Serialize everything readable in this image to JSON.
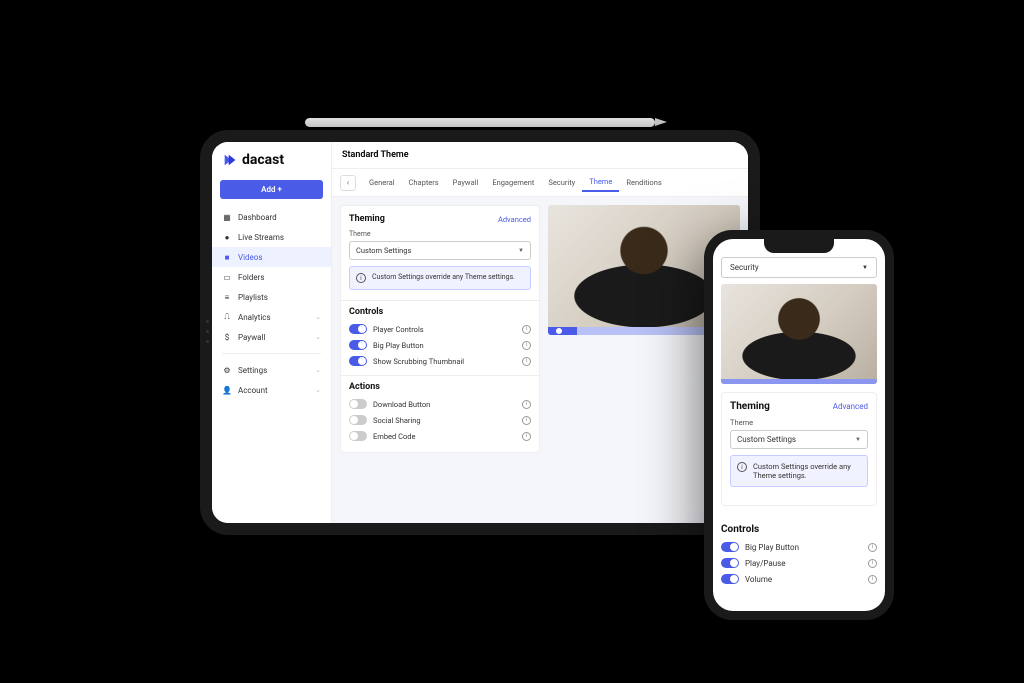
{
  "brand": {
    "name": "dacast"
  },
  "sidebar": {
    "add_label": "Add +",
    "items": [
      {
        "label": "Dashboard",
        "icon": "dashboard-icon"
      },
      {
        "label": "Live Streams",
        "icon": "camera-icon"
      },
      {
        "label": "Videos",
        "icon": "video-icon",
        "active": true
      },
      {
        "label": "Folders",
        "icon": "folder-icon"
      },
      {
        "label": "Playlists",
        "icon": "list-icon"
      },
      {
        "label": "Analytics",
        "icon": "chart-icon",
        "expandable": true
      },
      {
        "label": "Paywall",
        "icon": "dollar-icon",
        "expandable": true
      }
    ],
    "footer": [
      {
        "label": "Settings",
        "icon": "gear-icon",
        "expandable": true
      },
      {
        "label": "Account",
        "icon": "user-icon",
        "expandable": true
      }
    ]
  },
  "page": {
    "title": "Standard Theme",
    "tabs": [
      "General",
      "Chapters",
      "Paywall",
      "Engagement",
      "Security",
      "Theme",
      "Renditions"
    ],
    "active_tab": "Theme"
  },
  "theming": {
    "heading": "Theming",
    "advanced_link": "Advanced",
    "field_label": "Theme",
    "selected": "Custom Settings",
    "notice": "Custom Settings override any Theme settings."
  },
  "controls": {
    "heading": "Controls",
    "items": [
      {
        "label": "Player Controls",
        "on": true
      },
      {
        "label": "Big Play Button",
        "on": true
      },
      {
        "label": "Show Scrubbing Thumbnail",
        "on": true
      }
    ]
  },
  "actions": {
    "heading": "Actions",
    "items": [
      {
        "label": "Download Button",
        "on": false
      },
      {
        "label": "Social Sharing",
        "on": false
      },
      {
        "label": "Embed Code",
        "on": false
      }
    ]
  },
  "phone": {
    "select_value": "Security",
    "theming": {
      "heading": "Theming",
      "advanced_link": "Advanced",
      "field_label": "Theme",
      "selected": "Custom Settings",
      "notice": "Custom Settings override any Theme settings."
    },
    "controls": {
      "heading": "Controls",
      "items": [
        {
          "label": "Big Play Button",
          "on": true
        },
        {
          "label": "Play/Pause",
          "on": true
        },
        {
          "label": "Volume",
          "on": true
        }
      ]
    }
  }
}
